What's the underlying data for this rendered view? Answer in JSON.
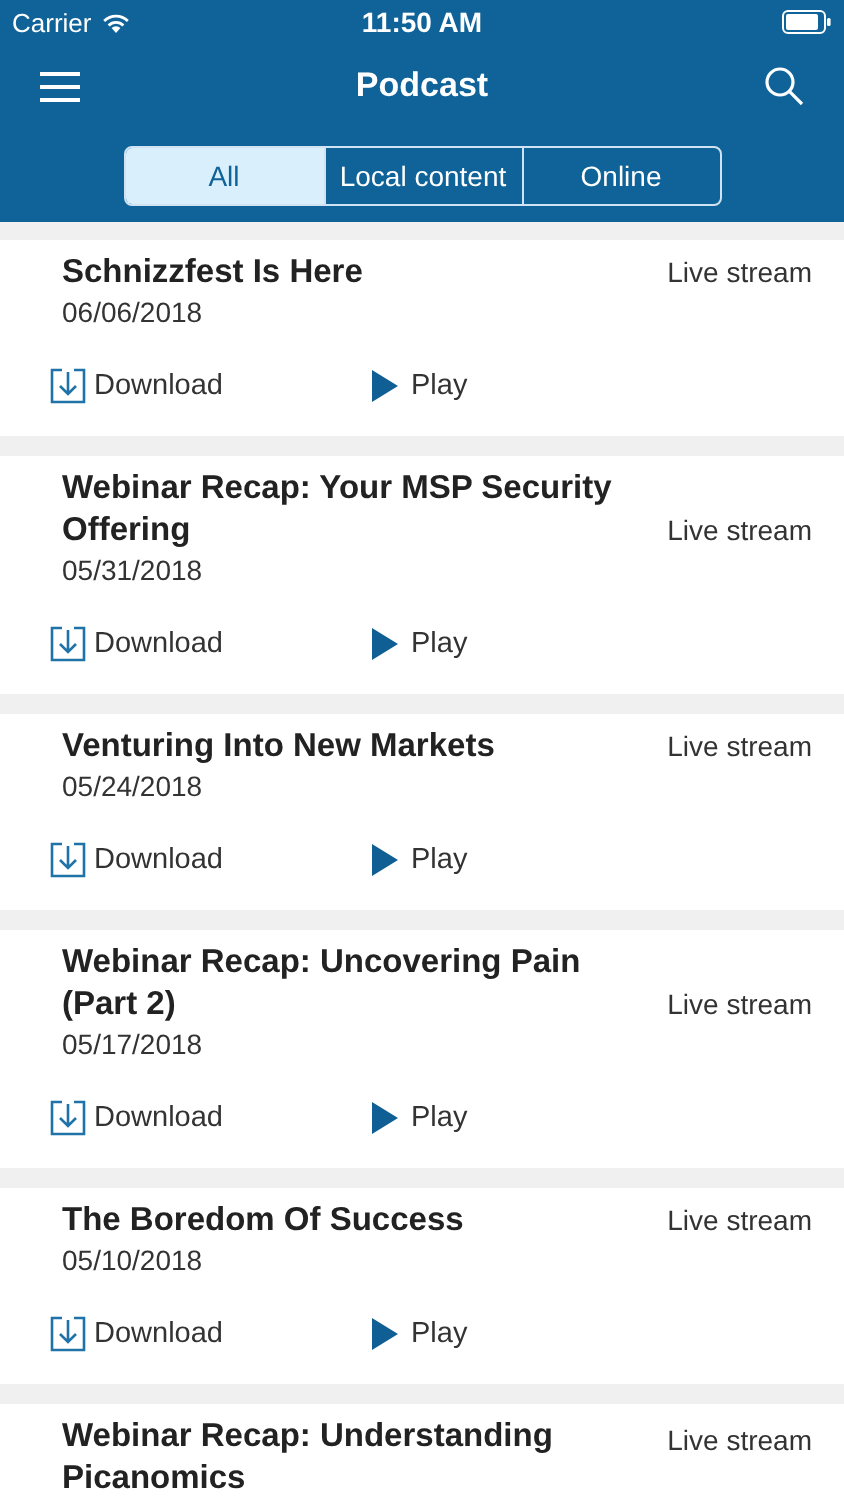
{
  "status_bar": {
    "carrier": "Carrier",
    "time": "11:50 AM"
  },
  "nav": {
    "title": "Podcast"
  },
  "tabs": [
    {
      "label": "All",
      "selected": true
    },
    {
      "label": "Local content",
      "selected": false
    },
    {
      "label": "Online",
      "selected": false
    }
  ],
  "episodes": [
    {
      "title": "Schnizzfest Is Here",
      "date": "06/06/2018",
      "source": "Live stream",
      "download": "Download",
      "play": "Play"
    },
    {
      "title": "Webinar Recap: Your MSP Security Offering",
      "date": "05/31/2018",
      "source": "Live stream",
      "download": "Download",
      "play": "Play"
    },
    {
      "title": "Venturing Into New Markets",
      "date": "05/24/2018",
      "source": "Live stream",
      "download": "Download",
      "play": "Play"
    },
    {
      "title": "Webinar Recap: Uncovering Pain (Part 2)",
      "date": "05/17/2018",
      "source": "Live stream",
      "download": "Download",
      "play": "Play"
    },
    {
      "title": "The Boredom Of Success",
      "date": "05/10/2018",
      "source": "Live stream",
      "download": "Download",
      "play": "Play"
    },
    {
      "title": "Webinar Recap: Understanding Picanomics",
      "source": "Live stream"
    }
  ]
}
